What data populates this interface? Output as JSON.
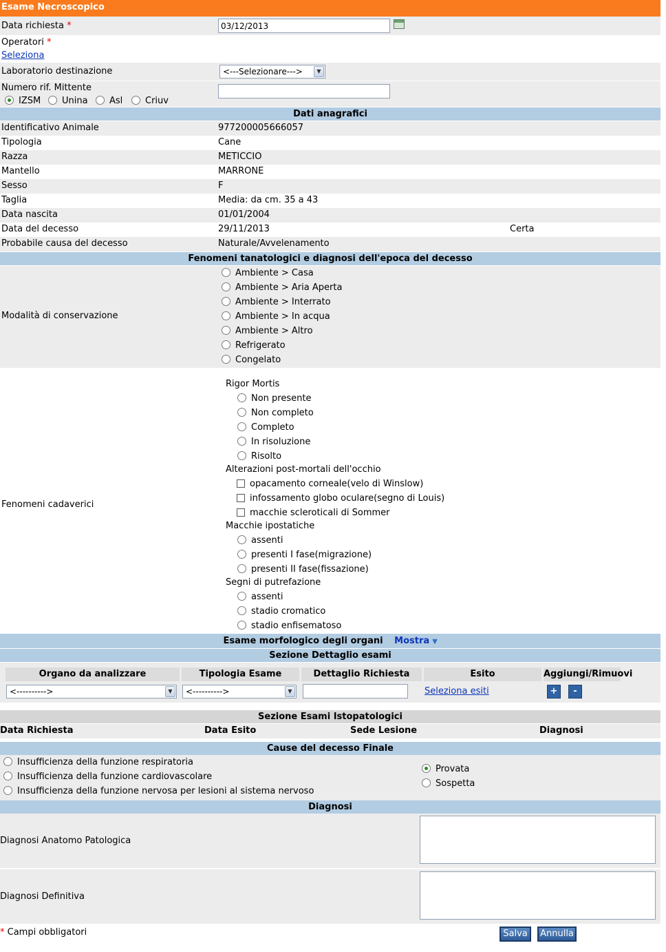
{
  "title": "Esame Necroscopico",
  "header_form": {
    "data_richiesta_label": "Data richiesta",
    "data_richiesta_value": "03/12/2013",
    "operatori_label": "Operatori",
    "seleziona_link": "Seleziona",
    "laboratorio_label": "Laboratorio destinazione",
    "laboratorio_value": "<---Selezionare--->",
    "numero_rif_label": "Numero rif. Mittente",
    "mittente_options": [
      "IZSM",
      "Unina",
      "Asl",
      "Criuv"
    ],
    "required_mark": "*"
  },
  "anagrafici": {
    "section_title": "Dati anagrafici",
    "rows": [
      {
        "label": "Identificativo Animale",
        "value": "977200005666057"
      },
      {
        "label": "Tipologia",
        "value": "Cane"
      },
      {
        "label": "Razza",
        "value": "METICCIO"
      },
      {
        "label": "Mantello",
        "value": "MARRONE"
      },
      {
        "label": "Sesso",
        "value": "F"
      },
      {
        "label": "Taglia",
        "value": "Media: da cm. 35 a 43"
      },
      {
        "label": "Data nascita",
        "value": "01/01/2004"
      },
      {
        "label": "Data del decesso",
        "value": "29/11/2013",
        "extra": "Certa"
      },
      {
        "label": "Probabile causa del decesso",
        "value": "Naturale/Avvelenamento"
      }
    ]
  },
  "fenomeni": {
    "section_title": "Fenomeni tanatologici e diagnosi dell'epoca del decesso",
    "conservazione_label": "Modalità di conservazione",
    "conservazione_options": [
      "Ambiente > Casa",
      "Ambiente > Aria Aperta",
      "Ambiente > Interrato",
      "Ambiente > In acqua",
      "Ambiente > Altro",
      "Refrigerato",
      "Congelato"
    ],
    "cadaverici_label": "Fenomeni cadaverici",
    "rigor_title": "Rigor Mortis",
    "rigor_options": [
      "Non presente",
      "Non completo",
      "Completo",
      "In risoluzione",
      "Risolto"
    ],
    "occhio_title": "Alterazioni post-mortali dell'occhio",
    "occhio_options": [
      "opacamento corneale(velo di Winslow)",
      "infossamento globo oculare(segno di Louis)",
      "macchie scleroticali di Sommer"
    ],
    "ipostatiche_title": "Macchie ipostatiche",
    "ipostatiche_options": [
      "assenti",
      "presenti I fase(migrazione)",
      "presenti II fase(fissazione)"
    ],
    "putrefazione_title": "Segni di putrefazione",
    "putrefazione_options": [
      "assenti",
      "stadio cromatico",
      "stadio enfisematoso"
    ]
  },
  "morfologico": {
    "title": "Esame morfologico degli organi",
    "mostra": "Mostra"
  },
  "dettaglio": {
    "section_title": "Sezione Dettaglio esami",
    "headers": [
      "Organo da analizzare",
      "Tipologia Esame",
      "Dettaglio Richiesta",
      "Esito",
      "Aggiungi/Rimuovi"
    ],
    "organo_value": "<---------->",
    "tipologia_value": "<---------->",
    "esito_link": "Seleziona esiti",
    "add_label": "+",
    "remove_label": "-"
  },
  "istopatologici": {
    "section_title": "Sezione Esami Istopatologici",
    "headers": [
      "Data Richiesta",
      "Data Esito",
      "Sede Lesione",
      "Diagnosi"
    ]
  },
  "cause": {
    "section_title": "Cause del decesso Finale",
    "options": [
      "Insufficienza della funzione respiratoria",
      "Insufficienza della funzione cardiovascolare",
      "Insufficienza della funzione nervosa per lesioni al sistema nervoso"
    ],
    "certainty_options": [
      "Provata",
      "Sospetta"
    ]
  },
  "diagnosi": {
    "section_title": "Diagnosi",
    "anatomo_label": "Diagnosi Anatomo Patologica",
    "definitiva_label": "Diagnosi Definitiva"
  },
  "footer": {
    "required_note": "Campi obbligatori",
    "save_label": "Salva",
    "cancel_label": "Annulla"
  },
  "colors": {
    "title_bar": "#f97b1d",
    "section_bar": "#b2cce2",
    "row_grey": "#ececec",
    "link": "#0b35b8",
    "button": "#2f5d99"
  }
}
